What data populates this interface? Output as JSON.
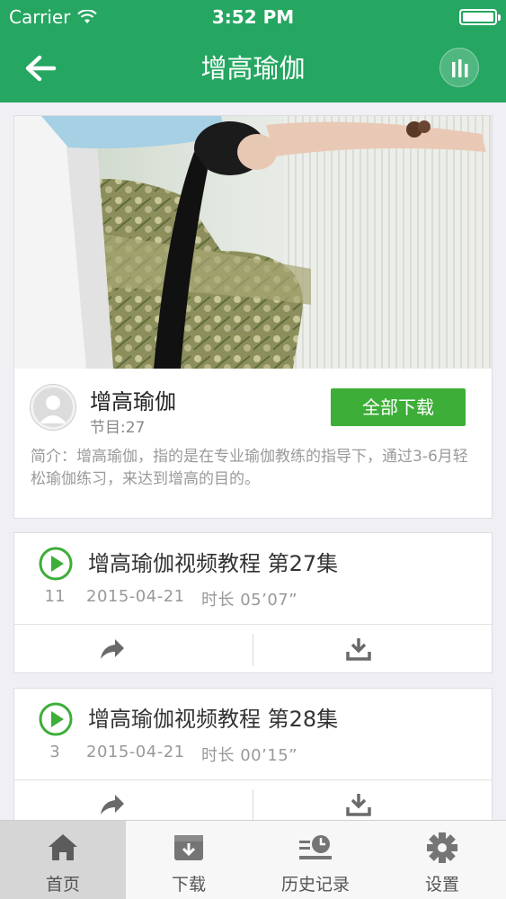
{
  "status_bar": {
    "carrier": "Carrier",
    "time": "3:52 PM"
  },
  "nav": {
    "title": "增高瑜伽",
    "back_icon": "arrow-left-icon",
    "action_icon": "equalizer-icon"
  },
  "album": {
    "title": "增高瑜伽",
    "episodes": "节目:27",
    "download_all_label": "全部下载",
    "description": "简介：增高瑜伽，指的是在专业瑜伽教练的指导下，通过3-6月轻松瑜伽练习，来达到增高的目的。"
  },
  "tracks": [
    {
      "title": "增高瑜伽视频教程 第27集",
      "plays": "11",
      "date": "2015-04-21",
      "duration": "时长 05’07”"
    },
    {
      "title": "增高瑜伽视频教程 第28集",
      "plays": "3",
      "date": "2015-04-21",
      "duration": "时长 00’15”"
    }
  ],
  "tab_bar": {
    "items": [
      {
        "label": "首页",
        "icon": "home-icon"
      },
      {
        "label": "下载",
        "icon": "download-box-icon"
      },
      {
        "label": "历史记录",
        "icon": "history-icon"
      },
      {
        "label": "设置",
        "icon": "gear-icon"
      }
    ],
    "active": "首页"
  },
  "colors": {
    "primary": "#25a661",
    "button_green": "#3dae38",
    "muted_text": "#999999"
  }
}
